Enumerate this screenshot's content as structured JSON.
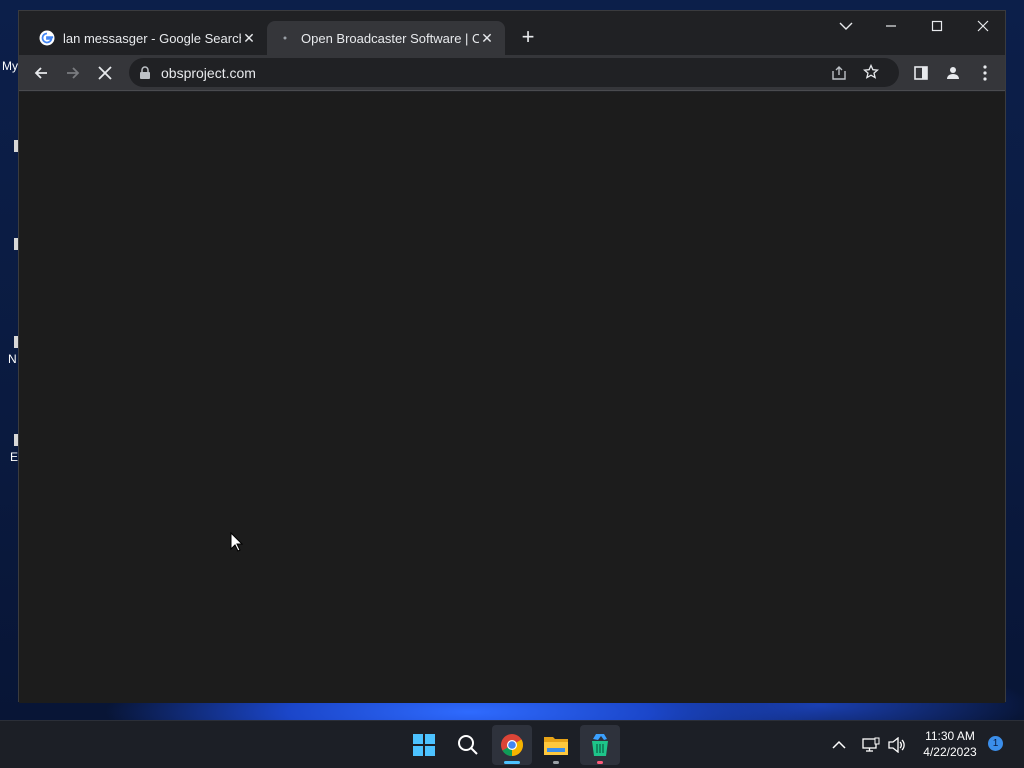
{
  "desktop": {
    "icon_labels": [
      "My",
      "N",
      "E"
    ]
  },
  "browser": {
    "tabs": [
      {
        "title": "lan messasger - Google Search",
        "favicon": "google-g-icon",
        "active": false
      },
      {
        "title": "Open Broadcaster Software | OBS",
        "favicon": "loading-icon",
        "active": true
      }
    ],
    "address": "obsproject.com",
    "page_state": "loading"
  },
  "taskbar": {
    "apps": [
      "start-icon",
      "search-icon",
      "chrome-icon",
      "file-explorer-icon",
      "recycle-app-icon"
    ],
    "clock_time": "11:30 AM",
    "clock_date": "4/22/2023",
    "notification_count": "1"
  },
  "colors": {
    "tab_active": "#35363a",
    "titlebar": "#202124",
    "content_bg": "#1c1c1c",
    "taskbar": "#1c1f26"
  }
}
